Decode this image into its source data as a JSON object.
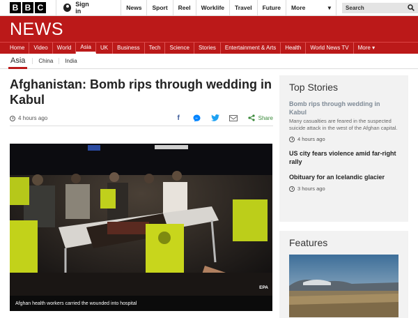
{
  "brand": {
    "letters": [
      "B",
      "B",
      "C"
    ]
  },
  "topbar": {
    "signin": "Sign in",
    "nav": [
      "News",
      "Sport",
      "Reel",
      "Worklife",
      "Travel",
      "Future"
    ],
    "more": "More",
    "more_arrow": "▾",
    "search_placeholder": "Search"
  },
  "news": {
    "title": "NEWS",
    "nav": [
      {
        "label": "Home"
      },
      {
        "label": "Video"
      },
      {
        "label": "World"
      },
      {
        "label": "Asia"
      },
      {
        "label": "UK"
      },
      {
        "label": "Business"
      },
      {
        "label": "Tech"
      },
      {
        "label": "Science"
      },
      {
        "label": "Stories"
      },
      {
        "label": "Entertainment & Arts"
      },
      {
        "label": "Health"
      },
      {
        "label": "World News TV"
      },
      {
        "label": "More ▾"
      }
    ],
    "active_index": 3
  },
  "subnav": {
    "current": "Asia",
    "items": [
      "China",
      "India"
    ]
  },
  "article": {
    "headline": "Afghanistan: Bomb rips through wedding in Kabul",
    "timestamp": "4 hours ago",
    "share_label": "Share",
    "share_icons": [
      "facebook-icon",
      "messenger-icon",
      "twitter-icon",
      "email-icon",
      "share-icon"
    ],
    "image_caption": "Afghan health workers carried the wounded into hospital",
    "image_credit": "EPA"
  },
  "sidebar": {
    "title": "Top Stories",
    "stories": [
      {
        "title": "Bomb rips through wedding in Kabul",
        "summary": "Many casualties are feared in the suspected suicide attack in the west of the Afghan capital.",
        "time": "4 hours ago"
      },
      {
        "title": "US city fears violence amid far-right rally",
        "summary": "",
        "time": ""
      },
      {
        "title": "Obituary for an Icelandic glacier",
        "summary": "",
        "time": "3 hours ago"
      }
    ]
  },
  "features": {
    "title": "Features"
  },
  "colors": {
    "brand_red": "#bb1919",
    "share_green": "#3b8a3b",
    "sidebar_bg": "#f2f2f2"
  }
}
